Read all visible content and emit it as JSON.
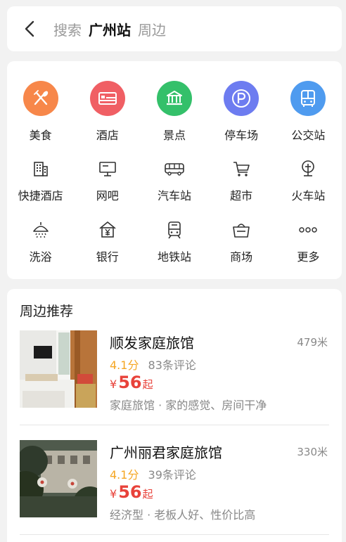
{
  "search": {
    "prefix": "搜索",
    "location": "广州站",
    "suffix": "周边"
  },
  "categories_primary": [
    {
      "label": "美食",
      "icon": "food-icon",
      "color": "#f7874a"
    },
    {
      "label": "酒店",
      "icon": "bed-icon",
      "color": "#f05f64"
    },
    {
      "label": "景点",
      "icon": "scenic-icon",
      "color": "#34c06a"
    },
    {
      "label": "停车场",
      "icon": "parking-icon",
      "color": "#6d7cf0"
    },
    {
      "label": "公交站",
      "icon": "bus-icon",
      "color": "#4f9bef"
    }
  ],
  "categories_secondary": [
    {
      "label": "快捷酒店",
      "icon": "budget-hotel-icon"
    },
    {
      "label": "网吧",
      "icon": "internet-cafe-icon"
    },
    {
      "label": "汽车站",
      "icon": "coach-station-icon"
    },
    {
      "label": "超市",
      "icon": "shopping-cart-icon"
    },
    {
      "label": "火车站",
      "icon": "train-station-icon"
    },
    {
      "label": "洗浴",
      "icon": "shower-icon"
    },
    {
      "label": "银行",
      "icon": "bank-icon"
    },
    {
      "label": "地铁站",
      "icon": "subway-icon"
    },
    {
      "label": "商场",
      "icon": "shopping-bag-icon"
    },
    {
      "label": "更多",
      "icon": "more-dots-icon"
    }
  ],
  "recommend": {
    "title": "周边推荐",
    "hotels": [
      {
        "name": "顺发家庭旅馆",
        "distance": "479米",
        "score": "4.1分",
        "reviews": "83条评论",
        "currency": "¥",
        "price": "56",
        "price_suffix": "起",
        "tags": "家庭旅馆 · 家的感觉、房间干净"
      },
      {
        "name": "广州丽君家庭旅馆",
        "distance": "330米",
        "score": "4.1分",
        "reviews": "39条评论",
        "currency": "¥",
        "price": "56",
        "price_suffix": "起",
        "tags": "经济型 · 老板人好、性价比高"
      }
    ]
  },
  "colors": {
    "rating": "#f5a623",
    "price": "#e8423a",
    "background": "#f2f2f2"
  }
}
